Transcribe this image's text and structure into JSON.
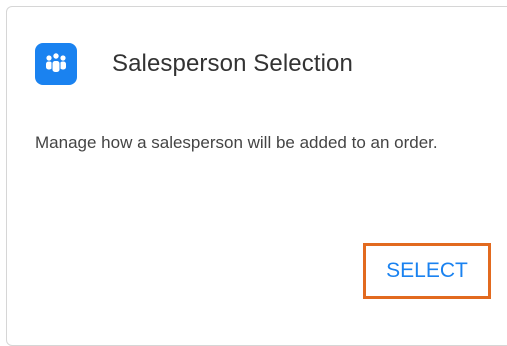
{
  "card": {
    "title": "Salesperson Selection",
    "icon": "team-people-icon",
    "description": "Manage how a salesperson will be added to an order.",
    "action_label": "SELECT"
  },
  "colors": {
    "accent": "#1a82f0",
    "highlight_border": "#e26a1f",
    "title_text": "#333333",
    "body_text": "#444444",
    "card_border": "#d6d6d6"
  }
}
